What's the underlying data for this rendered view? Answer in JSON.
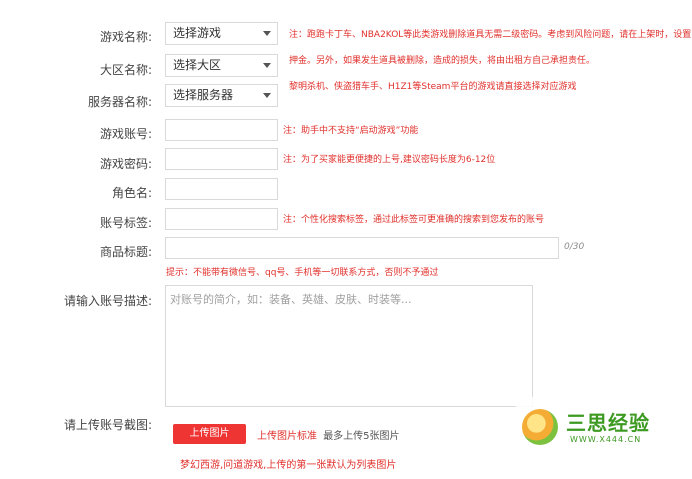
{
  "form": {
    "game_name": {
      "label": "游戏名称:",
      "value": "选择游戏",
      "note": "注：跑跑卡丁车、NBA2KOL等此类游戏删除道具无需二级密码。考虑到风险问题，请在上架时，设置"
    },
    "region": {
      "label": "大区名称:",
      "value": "选择大区",
      "note": "押金。另外，如果发生道具被删除，造成的损失，将由出租方自己承担责任。"
    },
    "server": {
      "label": "服务器名称:",
      "value": "选择服务器",
      "note": "黎明杀机、侠盗猎车手、H1Z1等Steam平台的游戏请直接选择对应游戏"
    },
    "account": {
      "label": "游戏账号:",
      "note": "注：助手中不支持“启动游戏”功能"
    },
    "password": {
      "label": "游戏密码:",
      "note": "注：为了买家能更便捷的上号,建议密码长度为6-12位"
    },
    "role": {
      "label": "角色名:"
    },
    "tag": {
      "label": "账号标签:",
      "note": "注：个性化搜索标签，通过此标签可更准确的搜索到您发布的账号"
    },
    "title": {
      "label": "商品标题:",
      "counter": "0/30",
      "hint": "提示：不能带有微信号、qq号、手机等一切联系方式，否则不予通过"
    },
    "description": {
      "label": "请输入账号描述:",
      "placeholder": "对账号的简介，如：装备、英雄、皮肤、时装等..."
    },
    "screenshot": {
      "label": "请上传账号截图:",
      "button": "上传图片",
      "standard_link": "上传图片标准",
      "limit": "最多上传5张图片",
      "tip": "梦幻西游,问道游戏,上传的第一张默认为列表图片"
    }
  },
  "watermark": {
    "name": "三思经验",
    "url": "WWW.X444.CN"
  },
  "colors": {
    "accent": "#ef3434",
    "note": "#e0302b",
    "border": "#d9d9d9"
  }
}
